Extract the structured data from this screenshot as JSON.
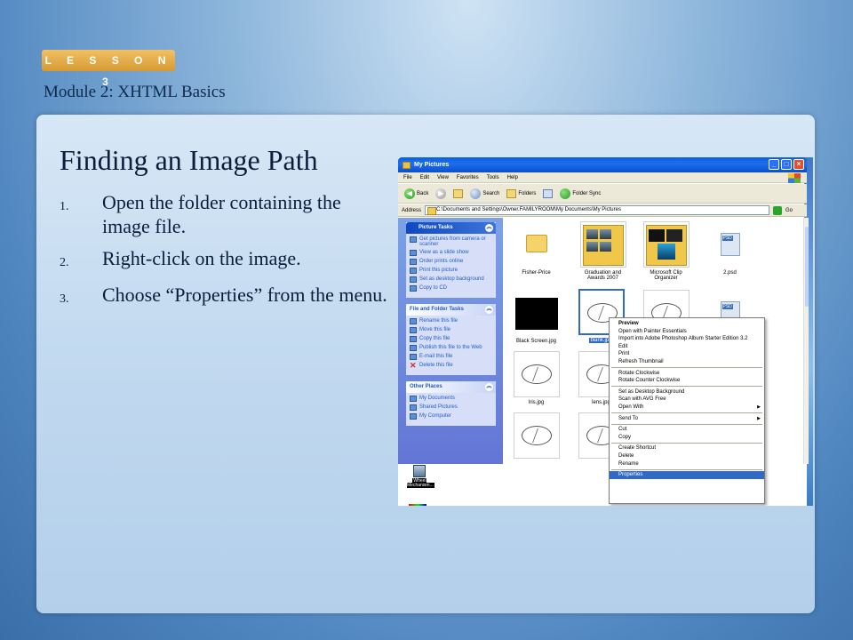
{
  "header": {
    "lesson_badge": "L E S S O N  3",
    "module_title": "Module 2: XHTML Basics"
  },
  "slide": {
    "title": "Finding an Image Path",
    "steps": [
      {
        "num": "1.",
        "text": "Open the folder containing the image file."
      },
      {
        "num": "2.",
        "text": "Right-click on the image."
      },
      {
        "num": "3.",
        "text": "Choose “Properties” from the menu."
      }
    ]
  },
  "explorer": {
    "window_title": "My Pictures",
    "title_buttons": {
      "minimize": "_",
      "maximize": "□",
      "close": "×"
    },
    "menu": [
      "File",
      "Edit",
      "View",
      "Favorites",
      "Tools",
      "Help"
    ],
    "toolbar": {
      "back": "Back",
      "search": "Search",
      "folders": "Folders",
      "folder_sync": "Folder Sync"
    },
    "address": {
      "label": "Address",
      "value": "C:\\Documents and Settings\\Owner.FAMILYROOM\\My Documents\\My Pictures",
      "go": "Go"
    },
    "picture_tasks": {
      "title": "Picture Tasks",
      "items": [
        "Get pictures from camera or scanner",
        "View as a slide show",
        "Order prints online",
        "Print this picture",
        "Set as desktop background",
        "Copy to CD"
      ]
    },
    "file_tasks": {
      "title": "File and Folder Tasks",
      "items": [
        "Rename this file",
        "Move this file",
        "Copy this file",
        "Publish this file to the Web",
        "E-mail this file",
        "Delete this file"
      ]
    },
    "other_places": {
      "title": "Other Places",
      "items": [
        "My Documents",
        "Shared Pictures",
        "My Computer"
      ]
    },
    "files": {
      "fisher_price": "Fisher-Price",
      "graduation": "Graduation and Awards 2007",
      "clip_organizer": "Microsoft Clip Organizer",
      "psd2": "2.psd",
      "black_screen": "Black Screen.jpg",
      "blank": "blank.jpg",
      "iris": "Iris.jpg",
      "lens": "lens.jpg"
    },
    "context_menu": [
      {
        "label": "Preview",
        "bold": true
      },
      {
        "label": "Open with Painter Essentials"
      },
      {
        "label": "Import into Adobe Photoshop Album Starter Edition 3.2"
      },
      {
        "label": "Edit"
      },
      {
        "label": "Print"
      },
      {
        "label": "Refresh Thumbnail"
      },
      {
        "sep": true
      },
      {
        "label": "Rotate Clockwise"
      },
      {
        "label": "Rotate Counter Clockwise"
      },
      {
        "sep": true
      },
      {
        "label": "Set as Desktop Background"
      },
      {
        "label": "Scan with AVG Free"
      },
      {
        "label": "Open With",
        "submenu": true
      },
      {
        "sep": true
      },
      {
        "label": "Send To",
        "submenu": true
      },
      {
        "sep": true
      },
      {
        "label": "Cut"
      },
      {
        "label": "Copy"
      },
      {
        "sep": true
      },
      {
        "label": "Create Shortcut"
      },
      {
        "label": "Delete"
      },
      {
        "label": "Rename"
      },
      {
        "sep": true
      },
      {
        "label": "Properties",
        "highlight": true
      }
    ],
    "desktop_icon": "Wheel Mechanism..."
  }
}
